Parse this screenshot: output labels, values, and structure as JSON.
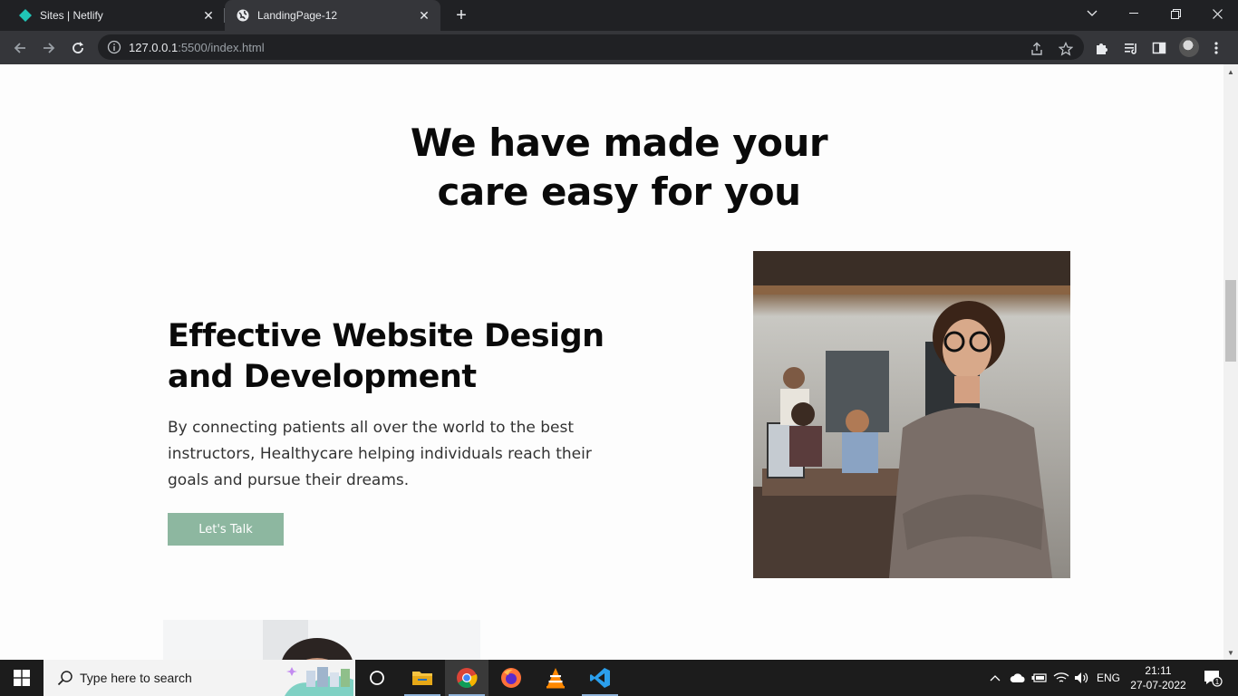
{
  "browser": {
    "tabs": [
      {
        "title": "Sites | Netlify",
        "icon": "netlify-icon"
      },
      {
        "title": "LandingPage-12",
        "icon": "globe-icon"
      }
    ],
    "url_host": "127.0.0.1",
    "url_rest": ":5500/index.html"
  },
  "page": {
    "heading_line1": "We have made your",
    "heading_line2": "care easy for you",
    "feature_title_line1": "Effective Website Design",
    "feature_title_line2": "and Development",
    "feature_text": "By connecting patients all over the world to the best instructors, Healthycare helping individuals reach their goals and pursue their dreams.",
    "cta_label": "Let's Talk",
    "colors": {
      "accent": "#8db7a0",
      "heading": "#0a0a0a",
      "body_text": "#333333"
    }
  },
  "taskbar": {
    "search_placeholder": "Type here to search",
    "language": "ENG",
    "time": "21:11",
    "date": "27-07-2022",
    "notification_count": "1"
  }
}
